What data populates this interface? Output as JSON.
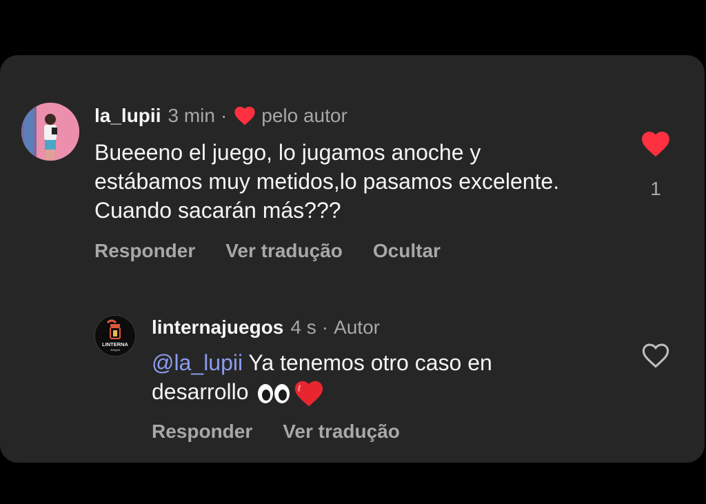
{
  "comment": {
    "username": "la_lupii",
    "time": "3 min",
    "separator": "·",
    "liked_by_author": "pelo autor",
    "text": "Bueeeno el juego, lo jugamos anoche y estábamos muy metidos,lo pasamos excelente. Cuando sacarán más???",
    "like_count": "1",
    "actions": {
      "reply": "Responder",
      "translate": "Ver tradução",
      "hide": "Ocultar"
    }
  },
  "reply": {
    "username": "linternajuegos",
    "time": "4 s",
    "separator": "·",
    "author_label": "Autor",
    "avatar_text": "LINTERNA",
    "avatar_subtext": "Juegos",
    "mention": "@la_lupii",
    "text_line1": " Ya tenemos otro caso en",
    "text_line2": "desarrollo",
    "actions": {
      "reply": "Responder",
      "translate": "Ver tradução"
    }
  },
  "icons": {
    "comment_like": "heart-filled-icon",
    "reply_like": "heart-outline-icon",
    "author_like": "heart-filled-icon",
    "emoji_eyes": "eyes-emoji",
    "emoji_heart": "red-heart-emoji"
  },
  "colors": {
    "background": "#000000",
    "card": "#262626",
    "text_primary": "#f5f5f5",
    "text_secondary": "#a8a8a8",
    "heart_red": "#ff3040",
    "mention_blue": "#8c9cf0"
  }
}
